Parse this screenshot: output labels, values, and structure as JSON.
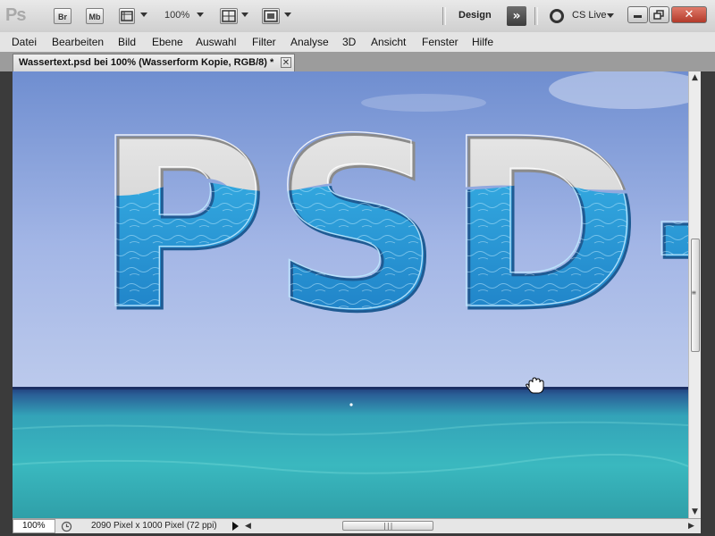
{
  "app": {
    "logo": "Ps",
    "bridge_label": "Br",
    "minibridge_label": "Mb",
    "zoom_label": "100%",
    "workspace_label": "Design",
    "cslive_label": "CS Live"
  },
  "menu": [
    "Datei",
    "Bearbeiten",
    "Bild",
    "Ebene",
    "Auswahl",
    "Filter",
    "Analyse",
    "3D",
    "Ansicht",
    "Fenster",
    "Hilfe"
  ],
  "document": {
    "tab_title": "Wassertext.psd bei 100% (Wasserform Kopie, RGB/8) *",
    "canvas_text": "PSD-T"
  },
  "statusbar": {
    "zoom": "100%",
    "info": "2090 Pixel x 1000 Pixel (72 ppi)"
  },
  "colors": {
    "sky_top": "#6f8ed0",
    "sky_bottom": "#b7c6ec",
    "sea_dark": "#1f3a78",
    "sea_turquoise": "#3ab8bf",
    "water_fill": "#2aa3de",
    "glass_fill": "#c9c9c9",
    "close_red": "#c9503f"
  },
  "icons": [
    "screen-mode-icon",
    "arrange-documents-icon",
    "view-extras-icon",
    "fast-forward-icon",
    "cs-live-icon",
    "minimize-icon",
    "restore-icon",
    "close-icon",
    "hand-tool-cursor-icon"
  ]
}
